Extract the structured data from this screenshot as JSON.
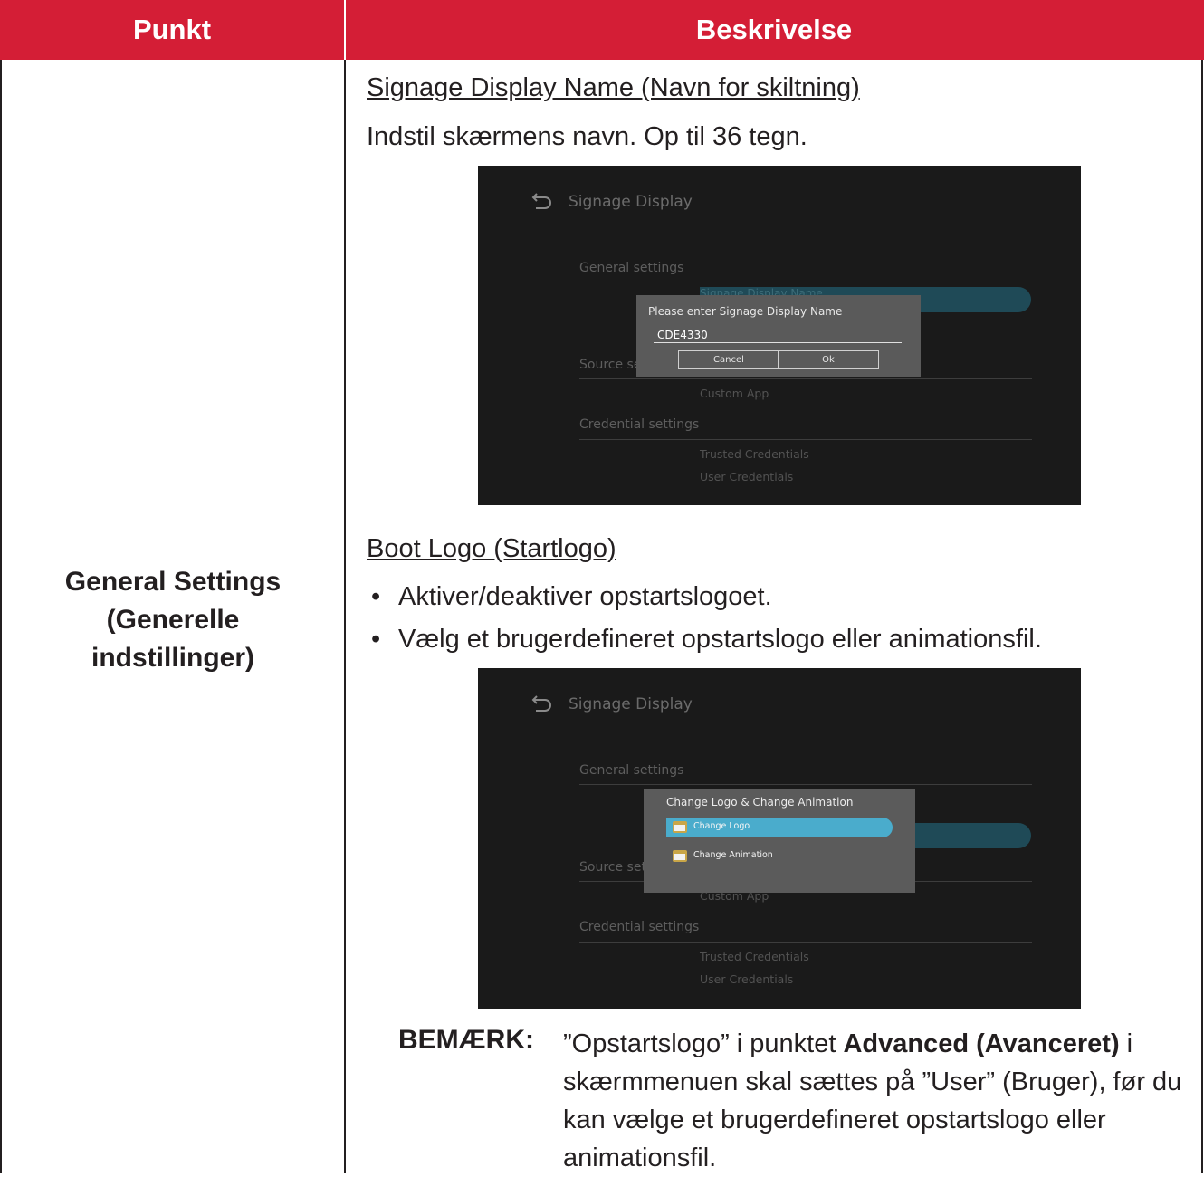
{
  "header": {
    "col_item": "Punkt",
    "col_description": "Beskrivelse"
  },
  "item": {
    "line1": "General Settings",
    "line2": "(Generelle",
    "line3": "indstillinger)"
  },
  "section1": {
    "title": "Signage Display Name (Navn for skiltning)",
    "text": "Indstil skærmens navn. Op til 36 tegn."
  },
  "screenshot1": {
    "title": "Signage Display",
    "general_settings": "General settings",
    "highlight_label": "Signage Display Name",
    "source_settings": "Source se",
    "custom_app": "Custom App",
    "credential_settings": "Credential settings",
    "trusted_credentials": "Trusted Credentials",
    "user_credentials": "User Credentials",
    "dialog": {
      "title": "Please enter Signage Display Name",
      "input_value": "CDE4330",
      "cancel": "Cancel",
      "ok": "Ok"
    }
  },
  "section2": {
    "title": "Boot Logo (Startlogo)",
    "bullets": [
      "Aktiver/deaktiver opstartslogoet.",
      "Vælg et brugerdefineret opstartslogo eller animationsfil."
    ]
  },
  "screenshot2": {
    "title": "Signage Display",
    "general_settings": "General settings",
    "source_settings": "Source set",
    "custom_app": "Custom App",
    "credential_settings": "Credential settings",
    "trusted_credentials": "Trusted Credentials",
    "user_credentials": "User Credentials",
    "dialog": {
      "title": "Change Logo & Change Animation",
      "options": [
        "Change Logo",
        "Change Animation"
      ]
    }
  },
  "note": {
    "label": "BEMÆRK:",
    "text_a": "”Opstartslogo” i punktet ",
    "text_bold": "Advanced (Avanceret)",
    "text_b": " i skærmmenuen skal sættes på ”User” (Bruger), før du kan vælge et brugerdefineret opstartslogo eller animationsfil."
  },
  "colors": {
    "header_bg": "#d41e36",
    "header_text": "#ffffff",
    "body_text": "#231f20",
    "screenshot_bg": "#1a1a1a",
    "highlight": "#1f4a57",
    "selected_option": "#4aaccc"
  }
}
